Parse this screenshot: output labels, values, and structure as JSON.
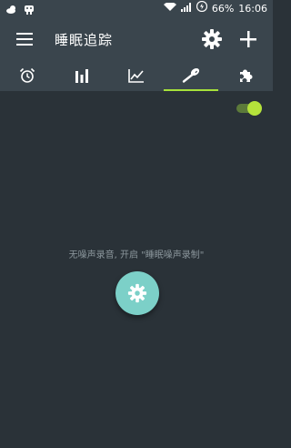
{
  "status_bar": {
    "battery": "66%",
    "time": "16:06"
  },
  "toolbar": {
    "title": "睡眠追踪"
  },
  "tabs": [
    {
      "icon": "alarm-icon",
      "active": false
    },
    {
      "icon": "bar-chart-icon",
      "active": false
    },
    {
      "icon": "trend-chart-icon",
      "active": false
    },
    {
      "icon": "noise-record-icon",
      "active": true
    },
    {
      "icon": "addons-icon",
      "active": false
    }
  ],
  "content": {
    "toggle_on": true,
    "empty_message": "无噪声录音, 开启 \"睡眠噪声录制\""
  },
  "colors": {
    "accent": "#a6e13a",
    "fab": "#7cd0c8",
    "background": "#2a3238",
    "toolbar": "#3a454d"
  }
}
